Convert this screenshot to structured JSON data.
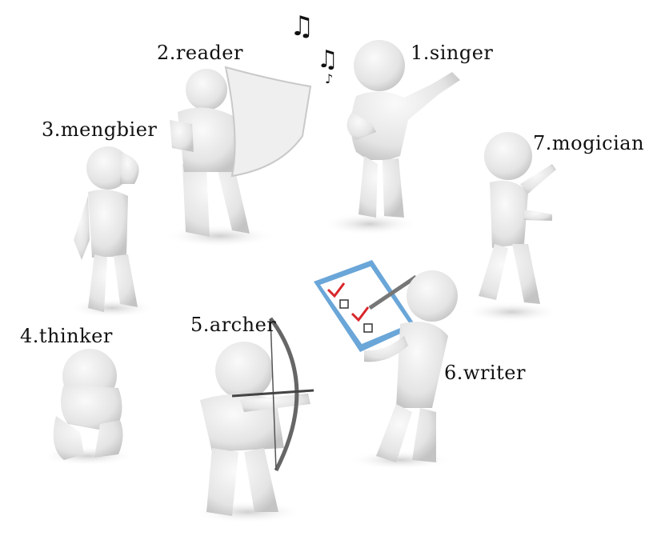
{
  "labels": {
    "singer": "1.singer",
    "reader": "2.reader",
    "mengbier": "3.mengbier",
    "thinker": "4.thinker",
    "archer": "5.archer",
    "writer": "6.writer",
    "mogician": "7.mogician"
  },
  "music_notes": "♫ ♪ ♫",
  "colors": {
    "figure": "#e8e8e8",
    "figure_shade": "#c9c9c9",
    "shadow": "#dcdcdc",
    "clipboard": "#6aa6d8",
    "check": "#d8262a"
  }
}
